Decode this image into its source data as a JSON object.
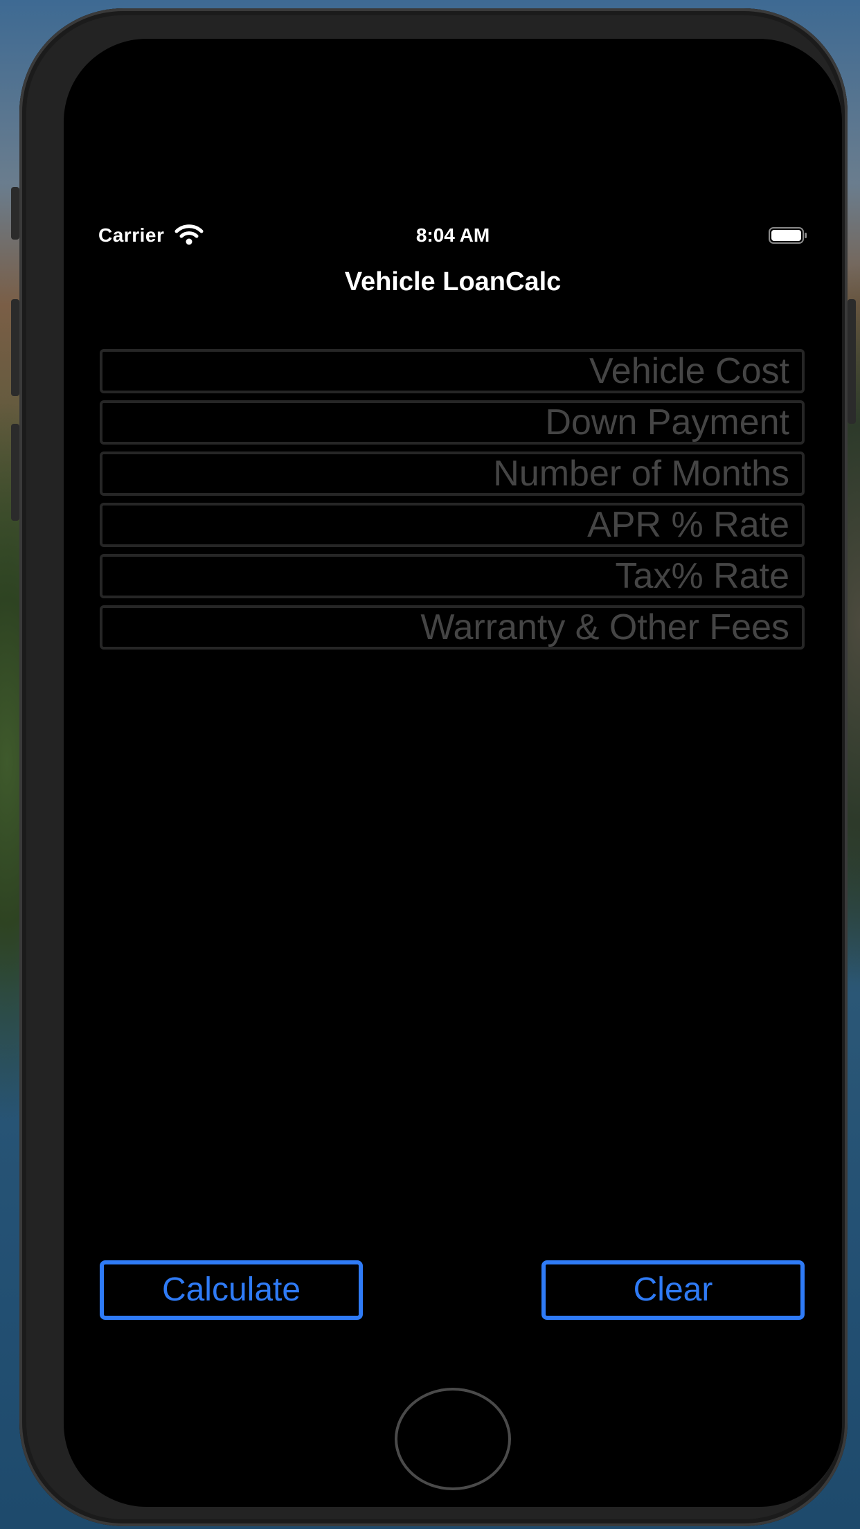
{
  "status_bar": {
    "carrier": "Carrier",
    "time": "8:04 AM",
    "wifi_icon": "wifi-icon",
    "battery_icon": "battery-full-icon"
  },
  "nav": {
    "title": "Vehicle LoanCalc"
  },
  "form": {
    "fields": [
      {
        "placeholder": "Vehicle Cost",
        "value": ""
      },
      {
        "placeholder": "Down Payment",
        "value": ""
      },
      {
        "placeholder": "Number of Months",
        "value": ""
      },
      {
        "placeholder": "APR % Rate",
        "value": ""
      },
      {
        "placeholder": "Tax% Rate",
        "value": ""
      },
      {
        "placeholder": "Warranty & Other Fees",
        "value": ""
      }
    ]
  },
  "actions": {
    "calculate_label": "Calculate",
    "clear_label": "Clear"
  },
  "colors": {
    "accent": "#2f7bf6",
    "background": "#000000",
    "placeholder": "#454545",
    "field_border": "#262626"
  }
}
